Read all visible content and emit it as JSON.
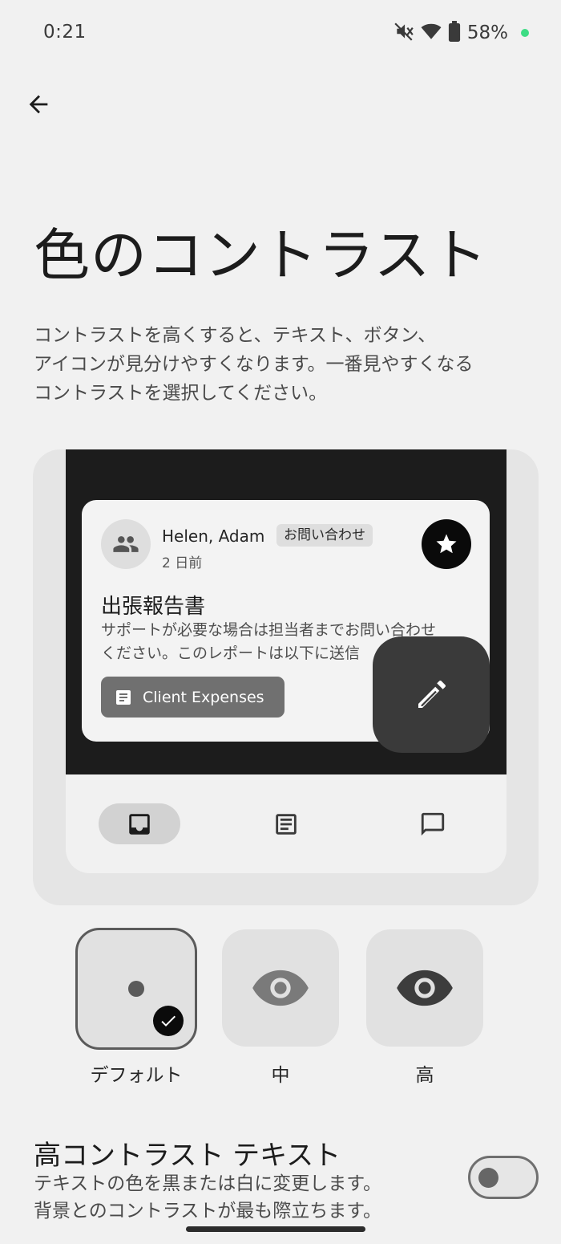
{
  "status_bar": {
    "time": "0:21",
    "battery_percent": "58%",
    "icons": [
      "mute-icon",
      "wifi-icon",
      "battery-icon"
    ],
    "dot_color": "#3ddc84"
  },
  "header": {
    "title": "色のコントラスト",
    "description": "コントラストを高くすると、テキスト、ボタン、\nアイコンが見分けやすくなります。一番見やすくなる\nコントラストを選択してください。"
  },
  "preview": {
    "sender": "Helen, Adam",
    "tag": "お問い合わせ",
    "date": "2 日前",
    "subject": "出張報告書",
    "body": "サポートが必要な場合は担当者までお問い合わせ\nください。このレポートは以下に送信",
    "attachment": "Client Expenses",
    "nav": [
      "inbox-icon",
      "article-icon",
      "chat-icon"
    ]
  },
  "contrast_options": [
    {
      "label": "デフォルト",
      "selected": true
    },
    {
      "label": "中",
      "selected": false
    },
    {
      "label": "高",
      "selected": false
    }
  ],
  "high_contrast_text": {
    "title": "高コントラスト テキスト",
    "description": "テキストの色を黒または白に変更します。\n背景とのコントラストが最も際立ちます。",
    "enabled": false
  }
}
